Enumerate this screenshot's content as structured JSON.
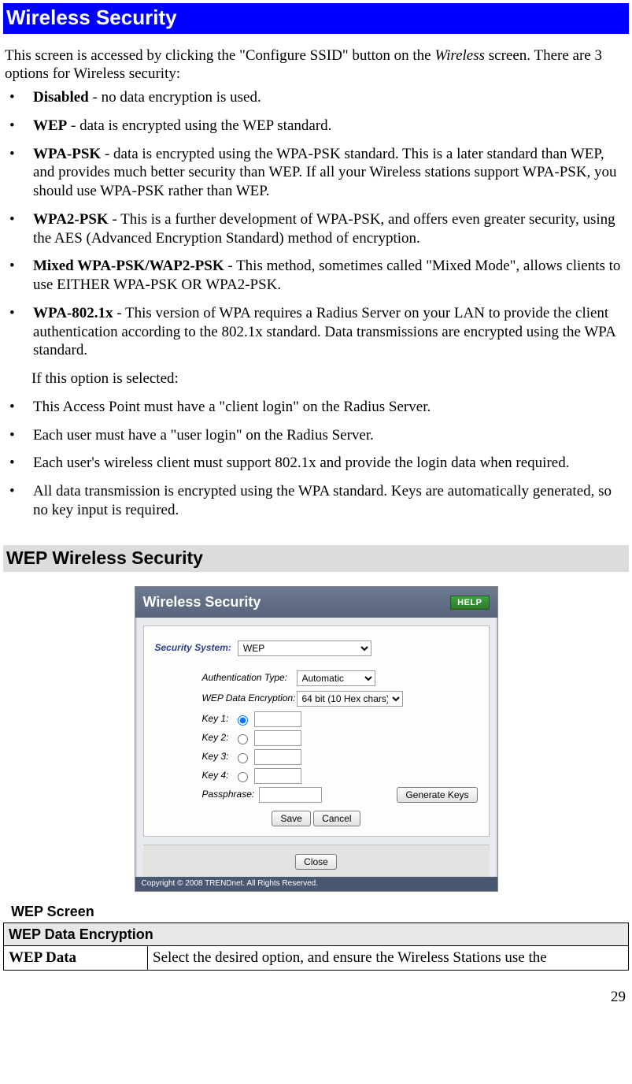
{
  "banner_title": "Wireless Security",
  "intro_html": "This screen is accessed by clicking the \"Configure SSID\" button on the <em>Wireless</em> screen. There are 3 options for Wireless security:",
  "options": [
    "<b>Disabled</b> - no data encryption is used.",
    "<b>WEP</b> - data is encrypted using the WEP standard.",
    "<b>WPA-PSK</b> - data is encrypted using the WPA-PSK standard. This is a later standard than WEP, and provides much better security than WEP. If all your Wireless stations support WPA-PSK, you should use WPA-PSK rather than WEP.",
    "<b>WPA2-PSK</b> - This is a further development of WPA-PSK, and offers even greater security, using the AES (Advanced Encryption Standard) method of encryption.",
    "<b>Mixed WPA-PSK/WAP2-PSK</b> - This method, sometimes called \"Mixed Mode\", allows clients to use EITHER WPA-PSK OR WPA2-PSK.",
    "<b>WPA-802.1x</b> - This version of WPA requires a Radius Server on your LAN to provide the client authentication according to the 802.1x standard. Data transmissions are encrypted using the WPA standard."
  ],
  "sub_note": "If this option is selected:",
  "sub_bullets": [
    "This Access Point must have a \"client login\" on the Radius Server.",
    "Each user must have a \"user login\" on the Radius Server.",
    "Each user's wireless client must support 802.1x and provide the login data when required.",
    "All data transmission is encrypted using the WPA standard. Keys are automatically generated, so no key input is required."
  ],
  "section_heading": "WEP Wireless Security",
  "screenshot": {
    "title": "Wireless Security",
    "help": "HELP",
    "security_system_label": "Security System:",
    "security_system_value": "WEP",
    "auth_type_label": "Authentication Type:",
    "auth_type_value": "Automatic",
    "wep_enc_label": "WEP Data Encryption:",
    "wep_enc_value": "64 bit (10 Hex chars)",
    "keys": [
      "Key 1:",
      "Key 2:",
      "Key 3:",
      "Key 4:"
    ],
    "passphrase_label": "Passphrase:",
    "generate_btn": "Generate Keys",
    "save_btn": "Save",
    "cancel_btn": "Cancel",
    "close_btn": "Close",
    "copyright": "Copyright © 2008 TRENDnet. All Rights Reserved."
  },
  "figure_caption": "WEP Screen",
  "table": {
    "header": "WEP Data Encryption",
    "row_label": "WEP Data",
    "row_text": "Select the desired option, and ensure the Wireless Stations use the"
  },
  "page_number": "29"
}
